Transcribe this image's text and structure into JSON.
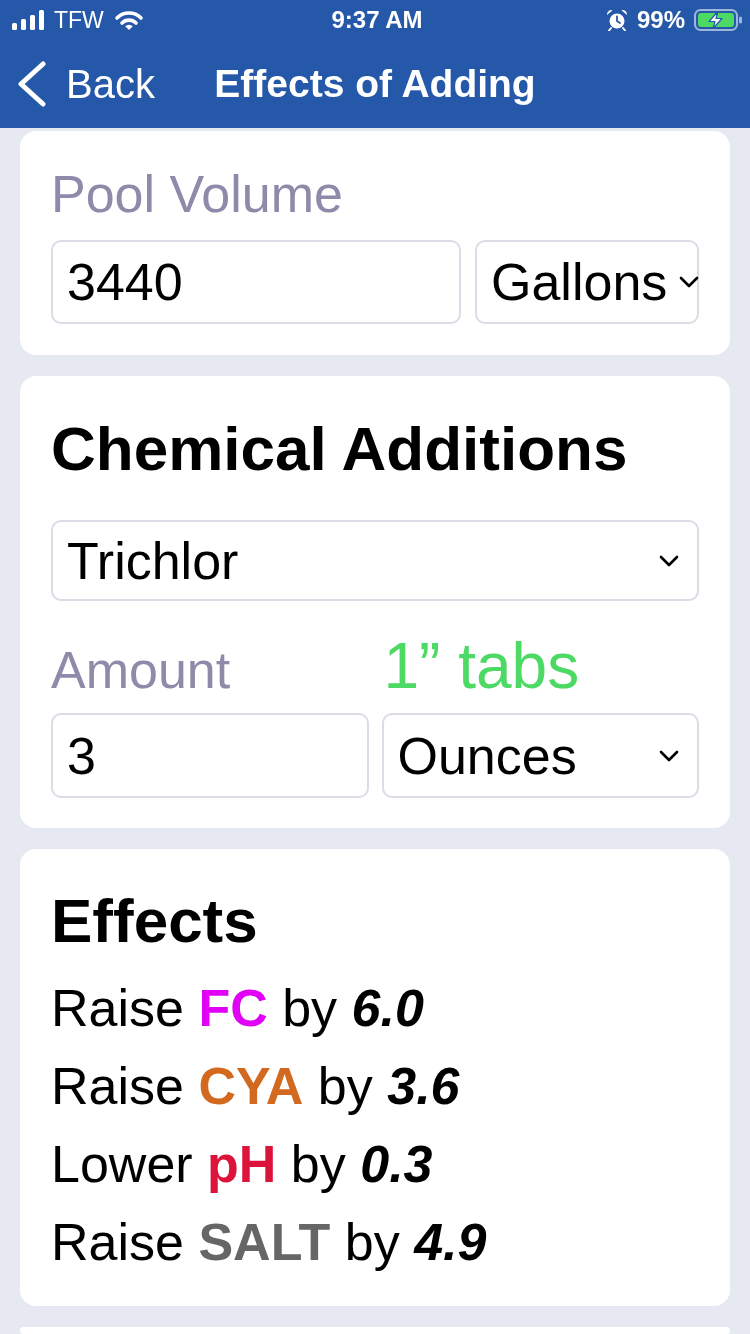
{
  "status_bar": {
    "carrier": "TFW",
    "time": "9:37 AM",
    "battery": "99%"
  },
  "nav_bar": {
    "back": "Back",
    "title": "Effects of Adding"
  },
  "pool_volume": {
    "label": "Pool Volume",
    "value": "3440",
    "unit": "Gallons"
  },
  "chemical_additions": {
    "title": "Chemical Additions",
    "chemical": "Trichlor",
    "amount_label": "Amount",
    "amount_hint": "1” tabs",
    "amount": "3",
    "amount_unit": "Ounces"
  },
  "effects": {
    "title": "Effects",
    "items": [
      {
        "verb": "Raise",
        "chemical": "FC",
        "color": "#e000f5",
        "connector": "by",
        "amount": "6.0"
      },
      {
        "verb": "Raise",
        "chemical": "CYA",
        "color": "#d2691e",
        "connector": "by",
        "amount": "3.6"
      },
      {
        "verb": "Lower",
        "chemical": "pH",
        "color": "#dc143c",
        "connector": "by",
        "amount": "0.3"
      },
      {
        "verb": "Raise",
        "chemical": "SALT",
        "color": "#666666",
        "connector": "by",
        "amount": "4.9"
      }
    ]
  }
}
